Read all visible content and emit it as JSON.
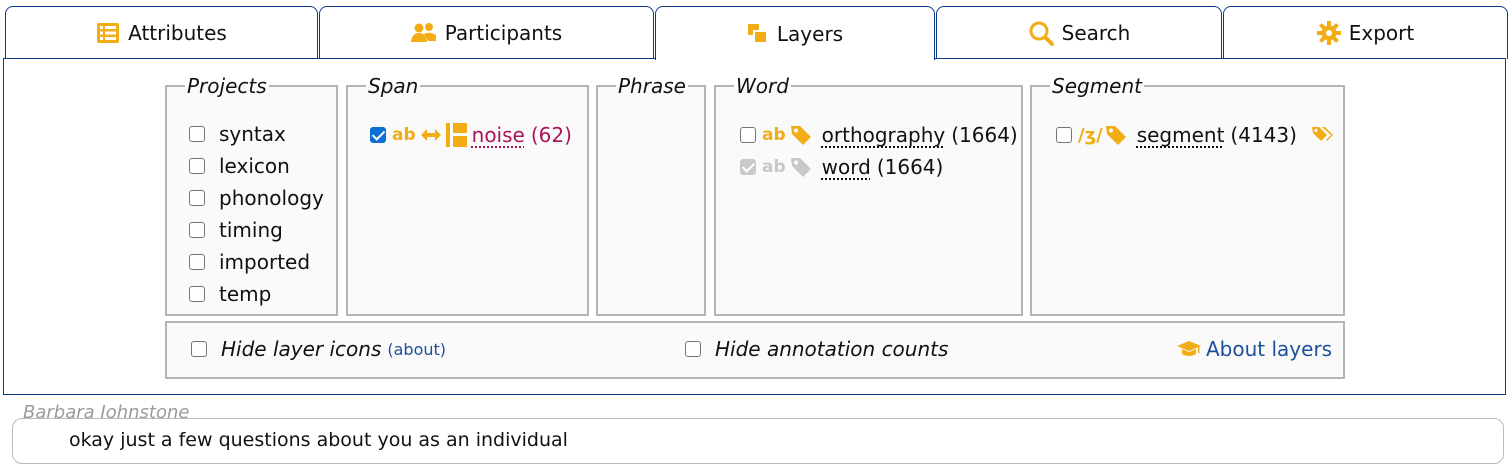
{
  "tabs": [
    {
      "label": "Attributes",
      "icon": "table-list-icon"
    },
    {
      "label": "Participants",
      "icon": "users-icon"
    },
    {
      "label": "Layers",
      "icon": "layers-icon",
      "active": true
    },
    {
      "label": "Search",
      "icon": "search-icon"
    },
    {
      "label": "Export",
      "icon": "gear-icon"
    }
  ],
  "groups": {
    "projects": {
      "legend": "Projects",
      "items": [
        "syntax",
        "lexicon",
        "phonology",
        "timing",
        "imported",
        "temp"
      ]
    },
    "span": {
      "legend": "Span",
      "layer": {
        "ab": "ab",
        "name": "noise",
        "count": "(62)",
        "checked": true
      }
    },
    "phrase": {
      "legend": "Phrase"
    },
    "word": {
      "legend": "Word",
      "layers": [
        {
          "ab": "ab",
          "name": "orthography",
          "count": "(1664)",
          "checked": false
        },
        {
          "ab": "ab",
          "name": "word",
          "count": "(1664)",
          "checked": true,
          "disabled": true
        }
      ]
    },
    "segment": {
      "legend": "Segment",
      "layer": {
        "ipa": "/ʒ/",
        "name": "segment",
        "count": "(4143)",
        "checked": false
      }
    }
  },
  "options": {
    "hide_icons": "Hide layer icons",
    "about": "(about)",
    "hide_counts": "Hide annotation counts",
    "about_layers": "About layers"
  },
  "transcript": {
    "speaker": "Barbara Johnstone",
    "text": "okay just a few questions about you as an individual"
  },
  "colors": {
    "accent": "#f2ac15",
    "border": "#0e3a84",
    "link": "#1d4f9a",
    "count_pink": "#a8155a"
  }
}
